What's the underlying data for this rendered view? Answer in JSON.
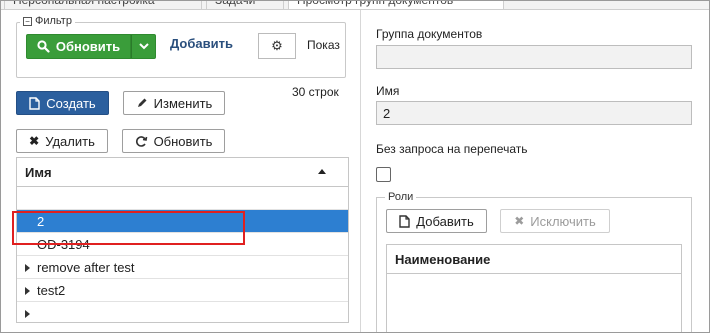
{
  "tabs": [
    {
      "label": "Персональная настройка"
    },
    {
      "label": "Задачи"
    },
    {
      "label": "Просмотр групп документов"
    }
  ],
  "filter": {
    "legend": "Фильтр",
    "refresh_label": "Обновить",
    "add_label": "Добавить",
    "show_label": "Показ"
  },
  "toolbar": {
    "create_label": "Создать",
    "edit_label": "Изменить",
    "rows_count": "30 строк",
    "delete_label": "Удалить",
    "refresh_label": "Обновить"
  },
  "grid": {
    "column_header": "Имя",
    "rows": [
      {
        "label": "",
        "expandable": false
      },
      {
        "label": "2",
        "expandable": false,
        "selected": true
      },
      {
        "label": "OD-3194",
        "expandable": false
      },
      {
        "label": "remove after test",
        "expandable": true
      },
      {
        "label": "test2",
        "expandable": true
      },
      {
        "label": "",
        "expandable": true
      }
    ]
  },
  "details": {
    "group_label": "Группа документов",
    "group_value": "",
    "name_label": "Имя",
    "name_value": "2",
    "no_reprint_label": "Без запроса на перепечать",
    "no_reprint_checked": false,
    "roles_legend": "Роли",
    "roles_add_label": "Добавить",
    "roles_exclude_label": "Исключить",
    "roles_column_header": "Наименование"
  },
  "colors": {
    "primary": "#2b5f9e",
    "success": "#3a9d3a",
    "selected_row": "#2d7fd1",
    "highlight_box": "#e02020"
  }
}
